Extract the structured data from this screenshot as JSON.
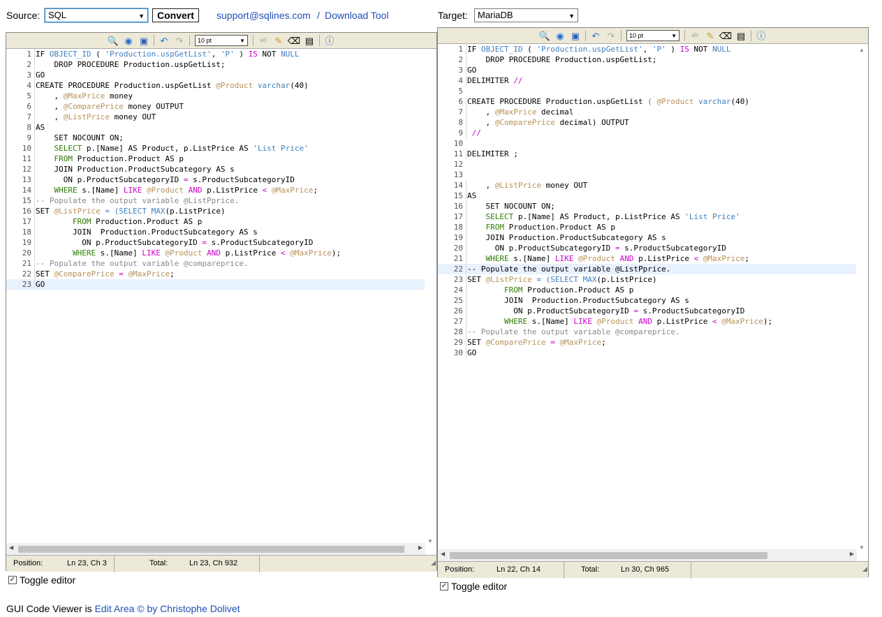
{
  "top": {
    "source_label": "Source:",
    "source_value": "SQL",
    "convert_label": "Convert",
    "support_link": "support@sqlines.com",
    "divider": "/",
    "download_link": "Download Tool",
    "target_label": "Target:",
    "target_value": "MariaDB"
  },
  "toolbar": {
    "font_size": "10 pt"
  },
  "source_editor": {
    "lines": [
      [
        [
          "IF ",
          "k"
        ],
        [
          "OBJECT_ID",
          "n"
        ],
        [
          " ( ",
          "k"
        ],
        [
          "'Production.uspGetList'",
          "s"
        ],
        [
          ", ",
          "k"
        ],
        [
          "'P'",
          "s"
        ],
        [
          " ) ",
          "k"
        ],
        [
          "IS",
          "o"
        ],
        [
          " NOT ",
          "k"
        ],
        [
          "NULL",
          "n"
        ]
      ],
      [
        [
          "    DROP PROCEDURE Production.uspGetList;",
          "k"
        ]
      ],
      [
        [
          "GO",
          "k"
        ]
      ],
      [
        [
          "CREATE PROCEDURE Production.uspGetList ",
          "k"
        ],
        [
          "@Product",
          "v"
        ],
        [
          " ",
          "k"
        ],
        [
          "varchar",
          "t"
        ],
        [
          "(40)",
          "k"
        ]
      ],
      [
        [
          "    , ",
          "k"
        ],
        [
          "@MaxPrice",
          "v"
        ],
        [
          " money",
          "k"
        ]
      ],
      [
        [
          "    , ",
          "k"
        ],
        [
          "@ComparePrice",
          "v"
        ],
        [
          " money OUTPUT",
          "k"
        ]
      ],
      [
        [
          "    , ",
          "k"
        ],
        [
          "@ListPrice",
          "v"
        ],
        [
          " money OUT",
          "k"
        ]
      ],
      [
        [
          "AS",
          "k"
        ]
      ],
      [
        [
          "    SET NOCOUNT ON;",
          "k"
        ]
      ],
      [
        [
          "    ",
          "k"
        ],
        [
          "SELECT",
          "kb"
        ],
        [
          " p.[Name] AS Product, p.ListPrice AS ",
          "k"
        ],
        [
          "'List Price'",
          "s"
        ]
      ],
      [
        [
          "    ",
          "k"
        ],
        [
          "FROM",
          "kb"
        ],
        [
          " Production.Product AS p",
          "k"
        ]
      ],
      [
        [
          "    JOIN Production.ProductSubcategory AS s",
          "k"
        ]
      ],
      [
        [
          "      ON p.ProductSubcategoryID ",
          "k"
        ],
        [
          "=",
          "o"
        ],
        [
          " s.ProductSubcategoryID",
          "k"
        ]
      ],
      [
        [
          "    ",
          "k"
        ],
        [
          "WHERE",
          "kb"
        ],
        [
          " s.[Name] ",
          "k"
        ],
        [
          "LIKE",
          "o"
        ],
        [
          " ",
          "k"
        ],
        [
          "@Product",
          "v"
        ],
        [
          " ",
          "k"
        ],
        [
          "AND",
          "o"
        ],
        [
          " p.ListPrice ",
          "k"
        ],
        [
          "<",
          "o"
        ],
        [
          " ",
          "k"
        ],
        [
          "@MaxPrice",
          "v"
        ],
        [
          ";",
          "k"
        ]
      ],
      [
        [
          "-- Populate the output variable @ListPprice.",
          "c"
        ]
      ],
      [
        [
          "SET ",
          "k"
        ],
        [
          "@ListPrice",
          "v"
        ],
        [
          " = (",
          "p"
        ],
        [
          "SELECT",
          "p"
        ],
        [
          " ",
          "k"
        ],
        [
          "MAX",
          "n"
        ],
        [
          "(p.ListPrice)",
          "k"
        ]
      ],
      [
        [
          "        ",
          "k"
        ],
        [
          "FROM",
          "kb"
        ],
        [
          " Production.Product AS p",
          "k"
        ]
      ],
      [
        [
          "        JOIN  Production.ProductSubcategory AS s",
          "k"
        ]
      ],
      [
        [
          "          ON p.ProductSubcategoryID ",
          "k"
        ],
        [
          "=",
          "o"
        ],
        [
          " s.ProductSubcategoryID",
          "k"
        ]
      ],
      [
        [
          "        ",
          "k"
        ],
        [
          "WHERE",
          "kb"
        ],
        [
          " s.[Name] ",
          "k"
        ],
        [
          "LIKE",
          "o"
        ],
        [
          " ",
          "k"
        ],
        [
          "@Product",
          "v"
        ],
        [
          " ",
          "k"
        ],
        [
          "AND",
          "o"
        ],
        [
          " p.ListPrice ",
          "k"
        ],
        [
          "<",
          "o"
        ],
        [
          " ",
          "k"
        ],
        [
          "@MaxPrice",
          "v"
        ],
        [
          ");",
          "k"
        ]
      ],
      [
        [
          "-- Populate the output variable @compareprice.",
          "c"
        ]
      ],
      [
        [
          "SET ",
          "k"
        ],
        [
          "@ComparePrice",
          "v"
        ],
        [
          " = ",
          "o"
        ],
        [
          "@MaxPrice",
          "v"
        ],
        [
          ";",
          "k"
        ]
      ],
      [
        [
          "GO",
          "k"
        ]
      ]
    ],
    "current_line": 23,
    "status": {
      "position_label": "Position:",
      "position_value": "Ln 23, Ch 3",
      "total_label": "Total:",
      "total_value": "Ln 23, Ch 932"
    },
    "toggle_label": "Toggle editor"
  },
  "target_editor": {
    "lines": [
      [
        [
          "IF ",
          "k"
        ],
        [
          "OBJECT_ID",
          "n"
        ],
        [
          " ( ",
          "k"
        ],
        [
          "'Production.uspGetList'",
          "s"
        ],
        [
          ", ",
          "k"
        ],
        [
          "'P'",
          "s"
        ],
        [
          " ) ",
          "k"
        ],
        [
          "IS",
          "o"
        ],
        [
          " NOT ",
          "k"
        ],
        [
          "NULL",
          "n"
        ]
      ],
      [
        [
          "    DROP PROCEDURE Production.uspGetList;",
          "k"
        ]
      ],
      [
        [
          "GO",
          "k"
        ]
      ],
      [
        [
          "DELIMITER ",
          "k"
        ],
        [
          "//",
          "o"
        ]
      ],
      [
        [
          "",
          "k"
        ]
      ],
      [
        [
          "CREATE PROCEDURE Production.uspGetList ",
          "k"
        ],
        [
          "( ",
          "n"
        ],
        [
          "@Product",
          "v"
        ],
        [
          " ",
          "k"
        ],
        [
          "varchar",
          "t"
        ],
        [
          "(40)",
          "k"
        ]
      ],
      [
        [
          "    , ",
          "k"
        ],
        [
          "@MaxPrice",
          "v"
        ],
        [
          " decimal",
          "k"
        ]
      ],
      [
        [
          "    , ",
          "k"
        ],
        [
          "@ComparePrice",
          "v"
        ],
        [
          " decimal) OUTPUT",
          "k"
        ]
      ],
      [
        [
          " //",
          "o"
        ]
      ],
      [
        [
          "",
          "k"
        ]
      ],
      [
        [
          "DELIMITER ;",
          "k"
        ]
      ],
      [
        [
          "",
          "k"
        ]
      ],
      [
        [
          "",
          "k"
        ]
      ],
      [
        [
          "    , ",
          "k"
        ],
        [
          "@ListPrice",
          "v"
        ],
        [
          " money OUT",
          "k"
        ]
      ],
      [
        [
          "AS",
          "k"
        ]
      ],
      [
        [
          "    SET NOCOUNT ON;",
          "k"
        ]
      ],
      [
        [
          "    ",
          "k"
        ],
        [
          "SELECT",
          "kb"
        ],
        [
          " p.[Name] AS Product, p.ListPrice AS ",
          "k"
        ],
        [
          "'List Price'",
          "s"
        ]
      ],
      [
        [
          "    ",
          "k"
        ],
        [
          "FROM",
          "kb"
        ],
        [
          " Production.Product AS p",
          "k"
        ]
      ],
      [
        [
          "    JOIN Production.ProductSubcategory AS s",
          "k"
        ]
      ],
      [
        [
          "      ON p.ProductSubcategoryID ",
          "k"
        ],
        [
          "=",
          "o"
        ],
        [
          " s.ProductSubcategoryID",
          "k"
        ]
      ],
      [
        [
          "    ",
          "k"
        ],
        [
          "WHERE",
          "kb"
        ],
        [
          " s.[Name] ",
          "k"
        ],
        [
          "LIKE",
          "o"
        ],
        [
          " ",
          "k"
        ],
        [
          "@Product",
          "v"
        ],
        [
          " ",
          "k"
        ],
        [
          "AND",
          "o"
        ],
        [
          " p.ListPrice ",
          "k"
        ],
        [
          "<",
          "o"
        ],
        [
          " ",
          "k"
        ],
        [
          "@MaxPrice",
          "v"
        ],
        [
          ";",
          "k"
        ]
      ],
      [
        [
          "-- Populate the output variable @ListPprice.",
          "k"
        ]
      ],
      [
        [
          "SET ",
          "k"
        ],
        [
          "@ListPrice",
          "v"
        ],
        [
          " = (",
          "p"
        ],
        [
          "SELECT",
          "p"
        ],
        [
          " ",
          "k"
        ],
        [
          "MAX",
          "n"
        ],
        [
          "(p.ListPrice)",
          "k"
        ]
      ],
      [
        [
          "        ",
          "k"
        ],
        [
          "FROM",
          "kb"
        ],
        [
          " Production.Product AS p",
          "k"
        ]
      ],
      [
        [
          "        JOIN  Production.ProductSubcategory AS s",
          "k"
        ]
      ],
      [
        [
          "          ON p.ProductSubcategoryID ",
          "k"
        ],
        [
          "=",
          "o"
        ],
        [
          " s.ProductSubcategoryID",
          "k"
        ]
      ],
      [
        [
          "        ",
          "k"
        ],
        [
          "WHERE",
          "kb"
        ],
        [
          " s.[Name] ",
          "k"
        ],
        [
          "LIKE",
          "o"
        ],
        [
          " ",
          "k"
        ],
        [
          "@Product",
          "v"
        ],
        [
          " ",
          "k"
        ],
        [
          "AND",
          "o"
        ],
        [
          " p.ListPrice ",
          "k"
        ],
        [
          "<",
          "o"
        ],
        [
          " ",
          "k"
        ],
        [
          "@MaxPrice",
          "v"
        ],
        [
          ");",
          "k"
        ]
      ],
      [
        [
          "-- Populate the output variable @compareprice.",
          "c"
        ]
      ],
      [
        [
          "SET ",
          "k"
        ],
        [
          "@ComparePrice",
          "v"
        ],
        [
          " = ",
          "o"
        ],
        [
          "@MaxPrice",
          "v"
        ],
        [
          ";",
          "k"
        ]
      ],
      [
        [
          "GO",
          "k"
        ]
      ]
    ],
    "current_line": 22,
    "status": {
      "position_label": "Position:",
      "position_value": "Ln 22, Ch 14",
      "total_label": "Total:",
      "total_value": "Ln 30, Ch 965"
    },
    "toggle_label": "Toggle editor"
  },
  "footer": {
    "prefix": "GUI Code Viewer is ",
    "link": "Edit Area © by Christophe Dolivet"
  },
  "icons": [
    "binoculars-icon",
    "goto-icon",
    "fullscreen-icon",
    "undo-icon",
    "redo-icon",
    "spellcheck-icon",
    "highlight-icon",
    "reset-highlight-icon",
    "word-wrap-icon",
    "help-icon"
  ]
}
